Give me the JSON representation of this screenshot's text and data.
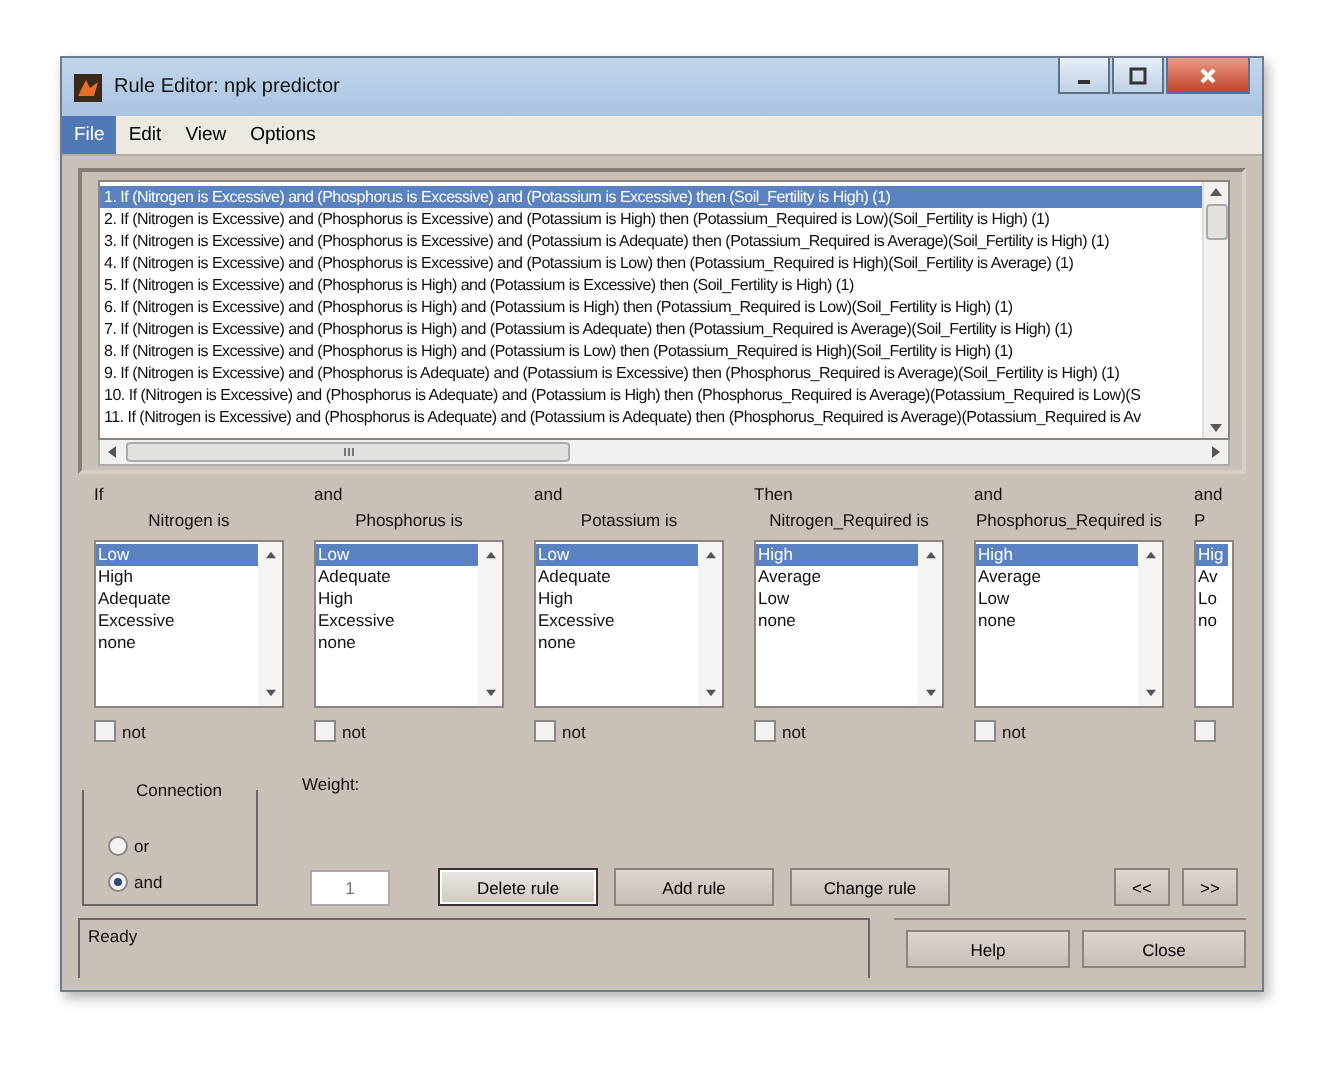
{
  "window": {
    "title": "Rule Editor: npk predictor"
  },
  "menu": [
    {
      "label": "File",
      "selected": true
    },
    {
      "label": "Edit",
      "selected": false
    },
    {
      "label": "View",
      "selected": false
    },
    {
      "label": "Options",
      "selected": false
    }
  ],
  "rules": [
    {
      "text": "1. If (Nitrogen is Excessive) and (Phosphorus is Excessive) and (Potassium is Excessive) then (Soil_Fertility is High) (1)",
      "selected": true
    },
    {
      "text": "2. If (Nitrogen is Excessive) and (Phosphorus is Excessive) and (Potassium is High) then (Potassium_Required is Low)(Soil_Fertility is High) (1)",
      "selected": false
    },
    {
      "text": "3. If (Nitrogen is Excessive) and (Phosphorus is Excessive) and (Potassium is Adequate) then (Potassium_Required is Average)(Soil_Fertility is High) (1)",
      "selected": false
    },
    {
      "text": "4. If (Nitrogen is Excessive) and (Phosphorus is Excessive) and (Potassium is Low) then (Potassium_Required is High)(Soil_Fertility is Average) (1)",
      "selected": false
    },
    {
      "text": "5. If (Nitrogen is Excessive) and (Phosphorus is High) and (Potassium is Excessive) then (Soil_Fertility is High) (1)",
      "selected": false
    },
    {
      "text": "6. If (Nitrogen is Excessive) and (Phosphorus is High) and (Potassium is High) then (Potassium_Required is Low)(Soil_Fertility is High) (1)",
      "selected": false
    },
    {
      "text": "7. If (Nitrogen is Excessive) and (Phosphorus is High) and (Potassium is Adequate) then (Potassium_Required is Average)(Soil_Fertility is High) (1)",
      "selected": false
    },
    {
      "text": "8. If (Nitrogen is Excessive) and (Phosphorus is High) and (Potassium is Low) then (Potassium_Required is High)(Soil_Fertility is High) (1)",
      "selected": false
    },
    {
      "text": "9. If (Nitrogen is Excessive) and (Phosphorus is Adequate) and (Potassium is Excessive) then (Phosphorus_Required is Average)(Soil_Fertility is High) (1)",
      "selected": false
    },
    {
      "text": "10. If (Nitrogen is Excessive) and (Phosphorus is Adequate) and (Potassium is High) then (Phosphorus_Required is Average)(Potassium_Required is Low)(S",
      "selected": false
    },
    {
      "text": "11. If (Nitrogen is Excessive) and (Phosphorus is Adequate) and (Potassium is Adequate) then (Phosphorus_Required is Average)(Potassium_Required is Av",
      "selected": false
    }
  ],
  "columns": [
    {
      "kind": "full",
      "connector": "If",
      "label": "Nitrogen is",
      "not_label": "not",
      "not": false,
      "items": [
        {
          "label": "Low",
          "selected": true
        },
        {
          "label": "High",
          "selected": false
        },
        {
          "label": "Adequate",
          "selected": false
        },
        {
          "label": "Excessive",
          "selected": false
        },
        {
          "label": "none",
          "selected": false
        }
      ]
    },
    {
      "kind": "full",
      "connector": "and",
      "label": "Phosphorus is",
      "not_label": "not",
      "not": false,
      "items": [
        {
          "label": "Low",
          "selected": true
        },
        {
          "label": "Adequate",
          "selected": false
        },
        {
          "label": "High",
          "selected": false
        },
        {
          "label": "Excessive",
          "selected": false
        },
        {
          "label": "none",
          "selected": false
        }
      ]
    },
    {
      "kind": "full",
      "connector": "and",
      "label": "Potassium is",
      "not_label": "not",
      "not": false,
      "items": [
        {
          "label": "Low",
          "selected": true
        },
        {
          "label": "Adequate",
          "selected": false
        },
        {
          "label": "High",
          "selected": false
        },
        {
          "label": "Excessive",
          "selected": false
        },
        {
          "label": "none",
          "selected": false
        }
      ]
    },
    {
      "kind": "full",
      "connector": "Then",
      "label": "Nitrogen_Required is",
      "not_label": "not",
      "not": false,
      "items": [
        {
          "label": "High",
          "selected": true
        },
        {
          "label": "Average",
          "selected": false
        },
        {
          "label": "Low",
          "selected": false
        },
        {
          "label": "none",
          "selected": false
        }
      ]
    },
    {
      "kind": "full",
      "connector": "and",
      "label": "Phosphorus_Required is",
      "not_label": "not",
      "not": false,
      "items": [
        {
          "label": "High",
          "selected": true
        },
        {
          "label": "Average",
          "selected": false
        },
        {
          "label": "Low",
          "selected": false
        },
        {
          "label": "none",
          "selected": false
        }
      ]
    },
    {
      "kind": "cut",
      "connector": "and",
      "label": "P",
      "not": false,
      "items": [
        {
          "label": "Hig",
          "selected": true
        },
        {
          "label": "Av",
          "selected": false
        },
        {
          "label": "Lo",
          "selected": false
        },
        {
          "label": "no",
          "selected": false
        }
      ]
    }
  ],
  "connection": {
    "label": "Connection",
    "options": [
      {
        "label": "or",
        "selected": false
      },
      {
        "label": "and",
        "selected": true
      }
    ]
  },
  "weight": {
    "label": "Weight:",
    "value": "1"
  },
  "buttons": [
    {
      "label": "Delete rule",
      "focused": true
    },
    {
      "label": "Add rule",
      "focused": false
    },
    {
      "label": "Change rule",
      "focused": false
    }
  ],
  "nav_buttons": [
    "<<",
    ">>"
  ],
  "status": "Ready",
  "footer_buttons": [
    "Help",
    "Close"
  ]
}
